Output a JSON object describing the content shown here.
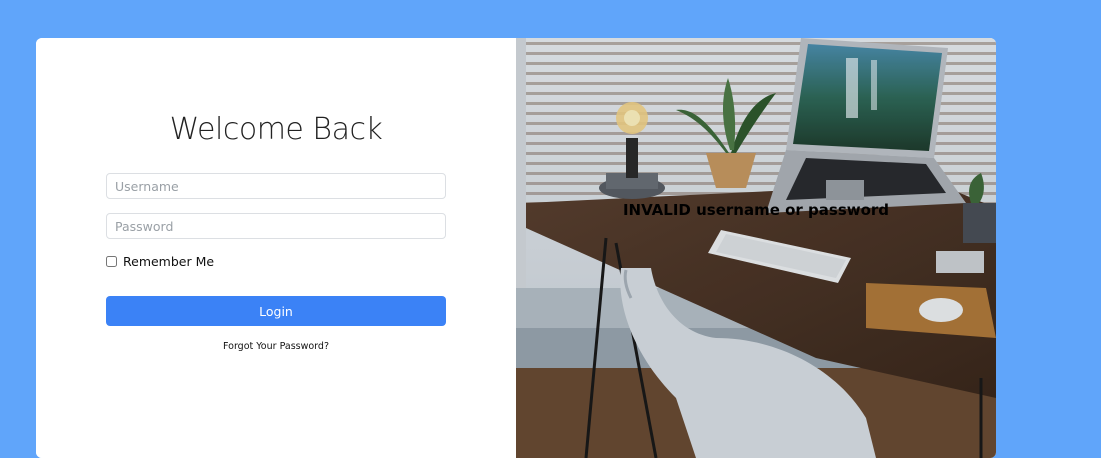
{
  "login": {
    "title": "Welcome Back",
    "username_placeholder": "Username",
    "password_placeholder": "Password",
    "remember_label": "Remember Me",
    "login_label": "Login",
    "forgot_label": "Forgot Your Password?"
  },
  "banner": {
    "error_message": "INVALID username or password"
  },
  "colors": {
    "background": "#60a5fa",
    "button": "#3b82f6"
  }
}
